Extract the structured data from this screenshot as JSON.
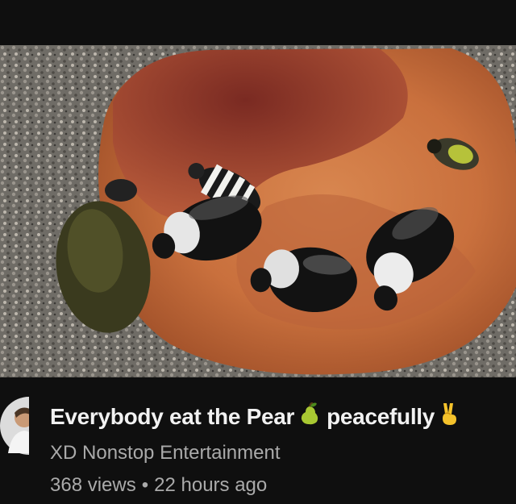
{
  "video": {
    "title_part1": "Everybody eat the Pear",
    "title_emoji_1": "pear-emoji",
    "title_part2": "peacefully",
    "title_emoji_2": "victory-hand-emoji",
    "channel": "XD Nonstop Entertainment",
    "views": "368 views",
    "separator": "•",
    "age": "22 hours ago"
  },
  "thumbnail": {
    "subject": "video-thumbnail-pear-with-bees-beetle-and-flies"
  },
  "colors": {
    "background": "#0f0f0f",
    "title_text": "#f1f1f1",
    "secondary_text": "#aaaaaa"
  }
}
